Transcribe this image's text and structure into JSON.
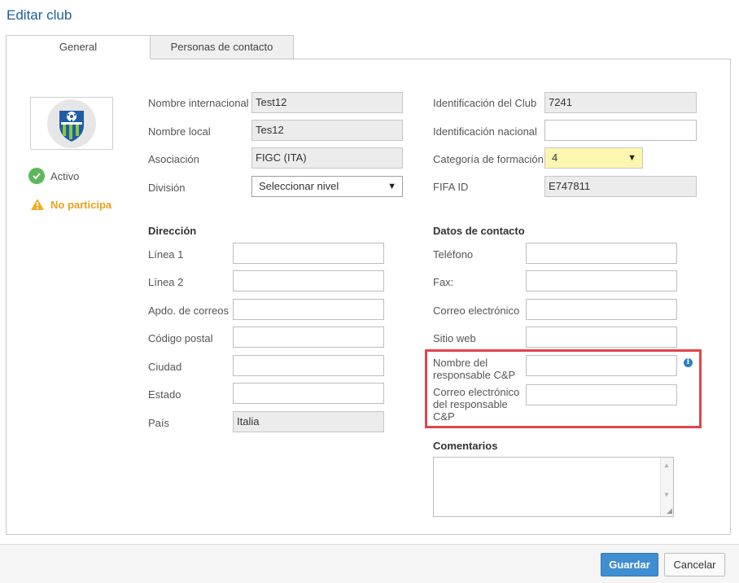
{
  "dialog": {
    "title": "Editar club"
  },
  "tabs": [
    {
      "label": "General",
      "active": true
    },
    {
      "label": "Personas de contacto",
      "active": false
    }
  ],
  "status": {
    "active": "Activo",
    "participation": "No participa"
  },
  "general": {
    "nombre_internacional": {
      "label": "Nombre internacional",
      "value": "Test12"
    },
    "nombre_local": {
      "label": "Nombre local",
      "value": "Tes12"
    },
    "asociacion": {
      "label": "Asociación",
      "value": "FIGC (ITA)"
    },
    "division": {
      "label": "División",
      "value": "Seleccionar nivel"
    },
    "identificacion_club": {
      "label": "Identificación del Club",
      "value": "7241"
    },
    "identificacion_nacional": {
      "label": "Identificación nacional",
      "value": ""
    },
    "categoria_formacion": {
      "label": "Categoría de formación",
      "value": "4"
    },
    "fifa_id": {
      "label": "FIFA ID",
      "value": "E747811"
    }
  },
  "direccion": {
    "title": "Dirección",
    "linea1": {
      "label": "Línea 1",
      "value": ""
    },
    "linea2": {
      "label": "Línea 2",
      "value": ""
    },
    "apdo": {
      "label": "Apdo. de correos",
      "value": ""
    },
    "codigo_postal": {
      "label": "Código postal",
      "value": ""
    },
    "ciudad": {
      "label": "Ciudad",
      "value": ""
    },
    "estado": {
      "label": "Estado",
      "value": ""
    },
    "pais": {
      "label": "País",
      "value": "Italia"
    }
  },
  "contacto": {
    "title": "Datos de contacto",
    "telefono": {
      "label": "Teléfono",
      "value": ""
    },
    "fax": {
      "label": "Fax:",
      "value": ""
    },
    "correo": {
      "label": "Correo electrónico",
      "value": ""
    },
    "sitio_web": {
      "label": "Sitio web",
      "value": ""
    },
    "responsable_nombre": {
      "label": "Nombre del responsable C&P",
      "value": ""
    },
    "responsable_correo": {
      "label": "Correo electrónico del responsable C&P",
      "value": ""
    }
  },
  "comentarios": {
    "title": "Comentarios",
    "value": ""
  },
  "footer": {
    "save_label": "Guardar",
    "cancel_label": "Cancelar"
  },
  "colors": {
    "accent": "#3f8ed1",
    "title": "#1f5f9f",
    "warning": "#e8a21b",
    "success": "#5cb85c",
    "highlight": "#e0454b",
    "select_yellow": "#fdf6b0"
  },
  "icons": {
    "status_active": "check-circle-icon",
    "status_warning": "warning-triangle-icon",
    "info": "info-icon",
    "logo": "club-shield-logo"
  }
}
